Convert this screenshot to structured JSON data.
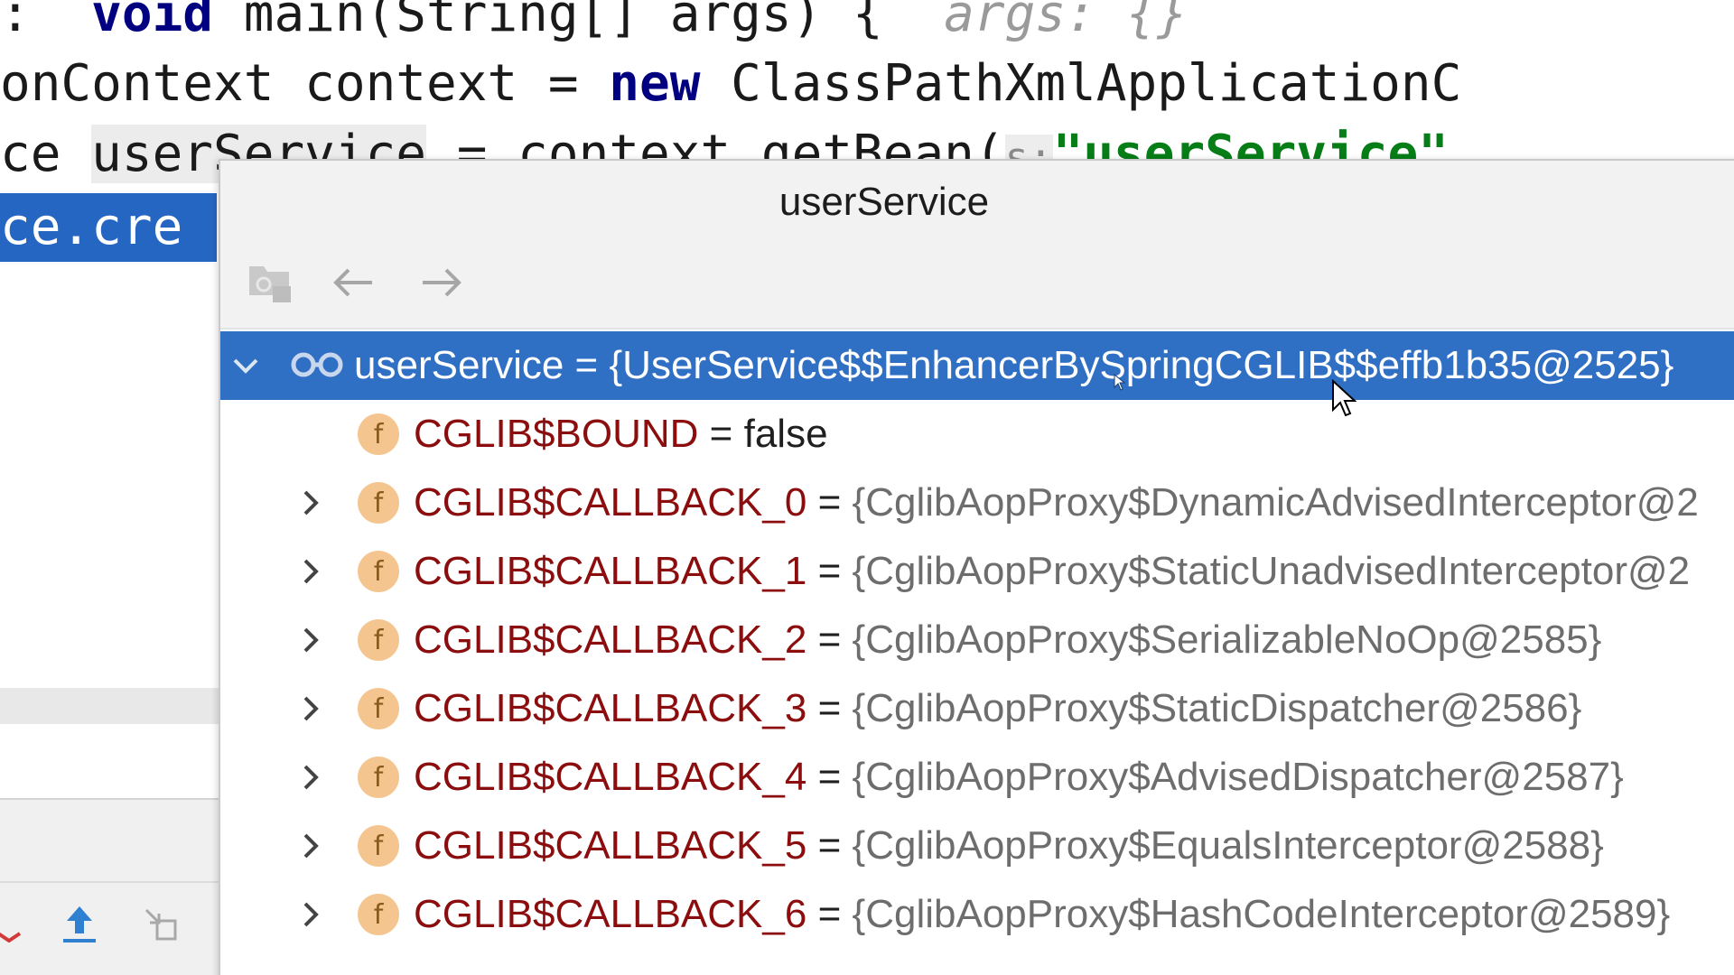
{
  "editor": {
    "lines": [
      {
        "kw": " void",
        "text": " main(String[] args) {  ",
        "hint": "args: {}"
      },
      {
        "prefix": "onContext context = ",
        "kw": "new",
        "suffix": " ClassPathXmlApplicationC"
      },
      {
        "prefix": "ce ",
        "var": "userService",
        "suffix": " = context.getBean(",
        "param_hint": "s:",
        "str": "\"userService\""
      },
      {
        "text": "ce.cre"
      }
    ]
  },
  "popup": {
    "title": "userService",
    "toolbar": {
      "inspect_icon": "inspect-object-icon",
      "back_icon": "arrow-left-icon",
      "forward_icon": "arrow-right-icon"
    },
    "root": {
      "name": "userService",
      "eq": "=",
      "value": "{UserService$$EnhancerBySpringCGLIB$$effb1b35@2525}",
      "expanded": true
    },
    "fields": [
      {
        "name": "CGLIB$BOUND",
        "eq": "=",
        "value": "false",
        "expandable": false,
        "plain": true
      },
      {
        "name": "CGLIB$CALLBACK_0",
        "eq": "=",
        "value": "{CglibAopProxy$DynamicAdvisedInterceptor@2",
        "expandable": true
      },
      {
        "name": "CGLIB$CALLBACK_1",
        "eq": "=",
        "value": "{CglibAopProxy$StaticUnadvisedInterceptor@2",
        "expandable": true
      },
      {
        "name": "CGLIB$CALLBACK_2",
        "eq": "=",
        "value": "{CglibAopProxy$SerializableNoOp@2585}",
        "expandable": true
      },
      {
        "name": "CGLIB$CALLBACK_3",
        "eq": "=",
        "value": "{CglibAopProxy$StaticDispatcher@2586}",
        "expandable": true
      },
      {
        "name": "CGLIB$CALLBACK_4",
        "eq": "=",
        "value": "{CglibAopProxy$AdvisedDispatcher@2587}",
        "expandable": true
      },
      {
        "name": "CGLIB$CALLBACK_5",
        "eq": "=",
        "value": "{CglibAopProxy$EqualsInterceptor@2588}",
        "expandable": true
      },
      {
        "name": "CGLIB$CALLBACK_6",
        "eq": "=",
        "value": "{CglibAopProxy$HashCodeInterceptor@2589}",
        "expandable": true
      }
    ],
    "field_badge": "f"
  },
  "colors": {
    "selection": "#2f6fc4",
    "field_name": "#8b0d0d",
    "field_badge": "#f5c58f",
    "keyword": "#000080",
    "string": "#067d17"
  }
}
